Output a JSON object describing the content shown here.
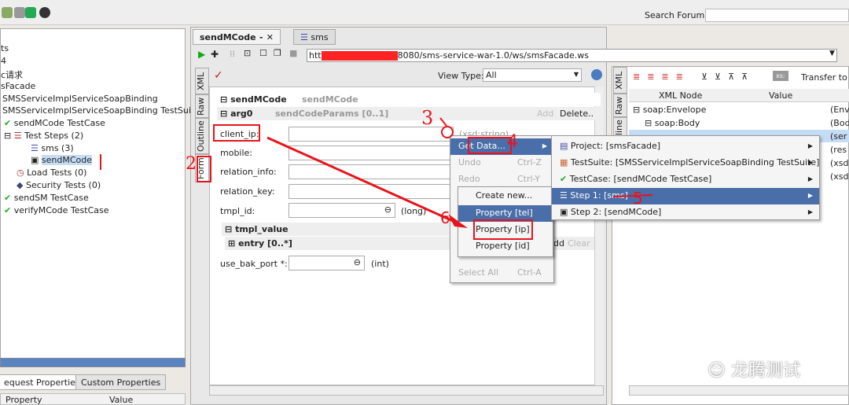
{
  "toolbar": {
    "search_label": "Search Forum"
  },
  "tree": [
    "ts",
    "4",
    "c请求",
    "sFacade",
    "SMSServiceImplServiceSoapBinding",
    "SMSServiceImplServiceSoapBinding TestSuite",
    "sendMCode TestCase",
    "Test Steps (2)",
    "sms (3)",
    "sendMCode",
    "Load Tests (0)",
    "Security Tests (0)",
    "sendSM TestCase",
    "verifyMCode TestCase"
  ],
  "left_tabs": [
    "equest Properties",
    "Custom Properties"
  ],
  "left_table": {
    "headers": [
      "Property",
      "Value"
    ]
  },
  "editor_tabs": [
    "sendMCode",
    "sms"
  ],
  "url": {
    "prefix": "htt",
    "suffix": "8080/sms-service-war-1.0/ws/smsFacade.ws"
  },
  "view_type": {
    "label": "View Type:",
    "value": "All"
  },
  "side_tabs": [
    "XML",
    "Raw",
    "Outline",
    "Form"
  ],
  "form": {
    "root": {
      "name": "sendMCode",
      "type": "sendMCode"
    },
    "arg0": {
      "name": "arg0",
      "type": "sendCodeParams [0..1]",
      "add": "Add",
      "delete": "Delete.."
    },
    "fields": [
      {
        "label": "client_ip:",
        "type": "(xsd:string)"
      },
      {
        "label": "mobile:"
      },
      {
        "label": "relation_info:"
      },
      {
        "label": "relation_key:"
      },
      {
        "label": "tmpl_id:",
        "type": "(long)"
      }
    ],
    "tmpl_value": "tmpl_value",
    "entry": {
      "name": "entry [0..*]",
      "add": "dd",
      "clear": "Clear"
    },
    "use_bak_port": {
      "label": "use_bak_port *:",
      "type": "(int)"
    }
  },
  "right": {
    "transfer": "Transfer to",
    "xs": "xs:",
    "headers": [
      "XML Node",
      "Value"
    ],
    "rows": [
      {
        "node": "soap:Envelope",
        "extra": "(Env"
      },
      {
        "node": "soap:Body",
        "extra": "(Bod"
      },
      {
        "node": "",
        "extra": "(ser"
      },
      {
        "node": "",
        "extra": "(res"
      },
      {
        "node": "",
        "extra": "(xsd"
      },
      {
        "node": "",
        "extra": "(xsd"
      }
    ],
    "side_tabs": [
      "XML",
      "Raw",
      "Outline"
    ]
  },
  "context_menu": {
    "items": [
      {
        "label": "Get Data...",
        "shortcut": ""
      },
      {
        "label": "Undo",
        "shortcut": "Ctrl-Z"
      },
      {
        "label": "Redo",
        "shortcut": "Ctrl-Y"
      },
      {
        "label": "Select All",
        "shortcut": "Ctrl-A"
      }
    ]
  },
  "step_submenu": [
    "Create new...",
    "Property [tel]",
    "Property [ip]",
    "Property [id]"
  ],
  "getdata_submenu": [
    "Project: [smsFacade]",
    "TestSuite: [SMSServiceImplServiceSoapBinding TestSuite]",
    "TestCase: [sendMCode TestCase]",
    "Step 1: [sms]",
    "Step 2: [sendMCode]"
  ],
  "annotations": [
    "1",
    "2",
    "3",
    "4",
    "5",
    "6"
  ],
  "watermark": "龙腾测试",
  "colors": {
    "menu_highlight": "#4a6ea9",
    "annotation": "#e8141b"
  }
}
